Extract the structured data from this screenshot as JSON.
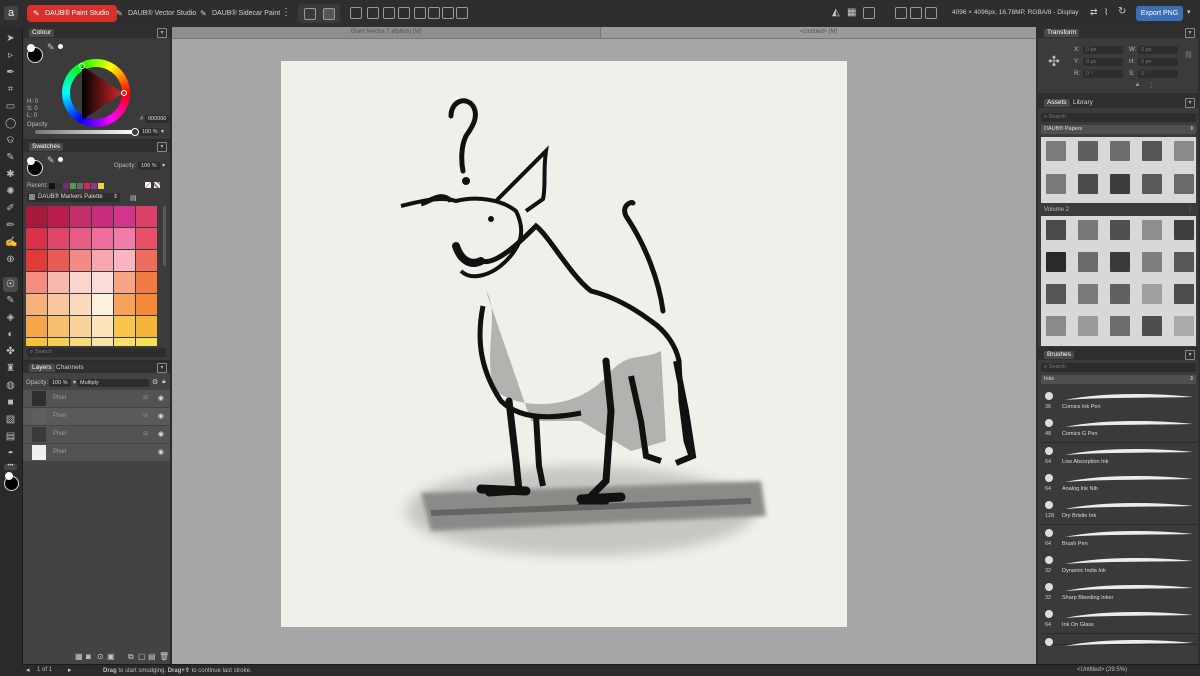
{
  "topbar": {
    "tabs": [
      {
        "label": "DAUB® Paint Studio",
        "active": true
      },
      {
        "label": "DAUB® Vector Studio",
        "active": false
      },
      {
        "label": "DAUB® Sidecar Paint",
        "active": false
      }
    ],
    "doc_info": "4096 × 4096px, 16.78MP, RGBA/8 - Display",
    "export_label": "Export PNG",
    "colors": {
      "active_tab": "#d9302c",
      "export": "#3d6fb6"
    }
  },
  "document_tabs": [
    "Giant Mecha 7.afphoto [M]",
    "<Untitled> [M]"
  ],
  "colour_panel": {
    "title": "Colour",
    "hsl": [
      "H: 0",
      "S: 0",
      "L: 0"
    ],
    "hex": "000000",
    "opacity_label": "Opacity",
    "opacity_value": "100 %"
  },
  "swatches_panel": {
    "title": "Swatches",
    "opacity_label": "Opacity:",
    "opacity_value": "100 %",
    "recent_label": "Recent:",
    "palette_name": "DAUB® Markers Palette",
    "search_placeholder": "Search",
    "recent_colors": [
      "#111111",
      "#333333",
      "#7a2a7a",
      "#4aa14a",
      "#6a6a6a",
      "#cc2b58",
      "#8a3a8a",
      "#f1d23a"
    ],
    "palette_colors": [
      [
        "#a8173c",
        "#b81d4c",
        "#c42e6a",
        "#c92c7b",
        "#d0368a",
        "#dd3f6b"
      ],
      [
        "#d9314a",
        "#e0456a",
        "#e75c86",
        "#ee6d9a",
        "#f17caa",
        "#e8506a"
      ],
      [
        "#e23a34",
        "#ea5a55",
        "#f48a86",
        "#f7a7b0",
        "#f9b6c2",
        "#ef6d5e"
      ],
      [
        "#f48d80",
        "#f7b9ae",
        "#f9d5cd",
        "#fbdcd6",
        "#f7a585",
        "#f07b45"
      ],
      [
        "#f6b07a",
        "#f8c7a0",
        "#fad9bc",
        "#fdf0de",
        "#f7a35b",
        "#f4893a"
      ],
      [
        "#f5a64a",
        "#f7bf6e",
        "#f9d49a",
        "#fbe4bc",
        "#f9c44b",
        "#f4b43a"
      ],
      [
        "#f2c23a",
        "#f5d056",
        "#f7dc80",
        "#f9e6a6",
        "#fadf6a",
        "#f4e15a"
      ]
    ]
  },
  "layers_panel": {
    "tabs": [
      "Layers",
      "Channels"
    ],
    "opacity_label": "Opacity:",
    "opacity_value": "100 %",
    "blend_mode": "Multiply",
    "layers": [
      {
        "name": "Pixel"
      },
      {
        "name": "Pixel"
      },
      {
        "name": "Pixel"
      },
      {
        "name": "Pixel"
      }
    ]
  },
  "transform_panel": {
    "title": "Transform",
    "fields": [
      {
        "label": "X:",
        "value": "0 px"
      },
      {
        "label": "W:",
        "value": "0 px"
      },
      {
        "label": "Y:",
        "value": "0 px"
      },
      {
        "label": "H:",
        "value": "0 px"
      },
      {
        "label": "R:",
        "value": "0 °"
      },
      {
        "label": "S:",
        "value": "0 °"
      }
    ]
  },
  "assets_panel": {
    "tabs": [
      "Assets",
      "Library"
    ],
    "search_placeholder": "Search",
    "category": "DAUB® Papers",
    "group2": "Volume 2"
  },
  "brushes_panel": {
    "title": "Brushes",
    "search_placeholder": "Search",
    "category": "Inks",
    "brushes": [
      {
        "size": "36",
        "name": "Comics Ink Pen"
      },
      {
        "size": "48",
        "name": "Comics G Pen"
      },
      {
        "size": "64",
        "name": "Low Absorption Ink"
      },
      {
        "size": "64",
        "name": "Analog Ink Nib"
      },
      {
        "size": "128",
        "name": "Dry Bristle Ink"
      },
      {
        "size": "64",
        "name": "Brush Pen"
      },
      {
        "size": "32",
        "name": "Dynamic India Ink"
      },
      {
        "size": "32",
        "name": "Sharp Bleeding Inker"
      },
      {
        "size": "64",
        "name": "Ink On Glass"
      },
      {
        "size": "",
        "name": ""
      }
    ]
  },
  "status": {
    "page": "1 of 1",
    "hint_bold1": "Drag",
    "hint1": " to start smudging. ",
    "hint_bold2": "Drag+⇧",
    "hint2": " to continue last stroke.",
    "doc_zoom": "<Untitled> (29.5%)"
  }
}
